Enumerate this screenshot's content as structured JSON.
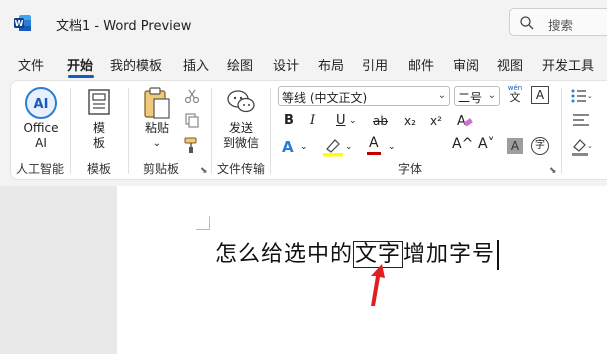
{
  "window": {
    "doc_title": "文档1  -  Word Preview",
    "search_label": "搜索"
  },
  "menu": {
    "tabs": [
      "文件",
      "开始",
      "我的模板",
      "插入",
      "绘图",
      "设计",
      "布局",
      "引用",
      "邮件",
      "审阅",
      "视图",
      "开发工具"
    ],
    "active_tab": "开始"
  },
  "ribbon": {
    "ai": {
      "button_label_1": "Office",
      "button_label_2": "AI",
      "group": "人工智能"
    },
    "template": {
      "button_label_1": "模",
      "button_label_2": "板",
      "group": "模板"
    },
    "clipboard": {
      "paste_label": "粘贴",
      "group": "剪贴板"
    },
    "transfer": {
      "button_label_1": "发送",
      "button_label_2": "到微信",
      "group": "文件传输"
    },
    "font": {
      "font_name": "等线 (中文正文)",
      "font_size": "二号",
      "group": "字体",
      "bold": "B",
      "italic": "I",
      "underline": "U",
      "strike": "ab",
      "subscript": "x₂",
      "superscript": "x²",
      "pinyin_top": "wén",
      "pinyin_char": "文",
      "char_border": "A",
      "text_effect": "A",
      "font_color": "A",
      "grow": "A^",
      "shrink": "A˅",
      "shading": "A",
      "enclose": "字"
    }
  },
  "document": {
    "before_selection": "怎么给选中的",
    "selection": "文字",
    "after_selection": "增加字号"
  },
  "colors": {
    "accent": "#185abd",
    "highlight": "#ffff00",
    "font_color": "#c00000",
    "annotation_arrow": "#e02020"
  }
}
